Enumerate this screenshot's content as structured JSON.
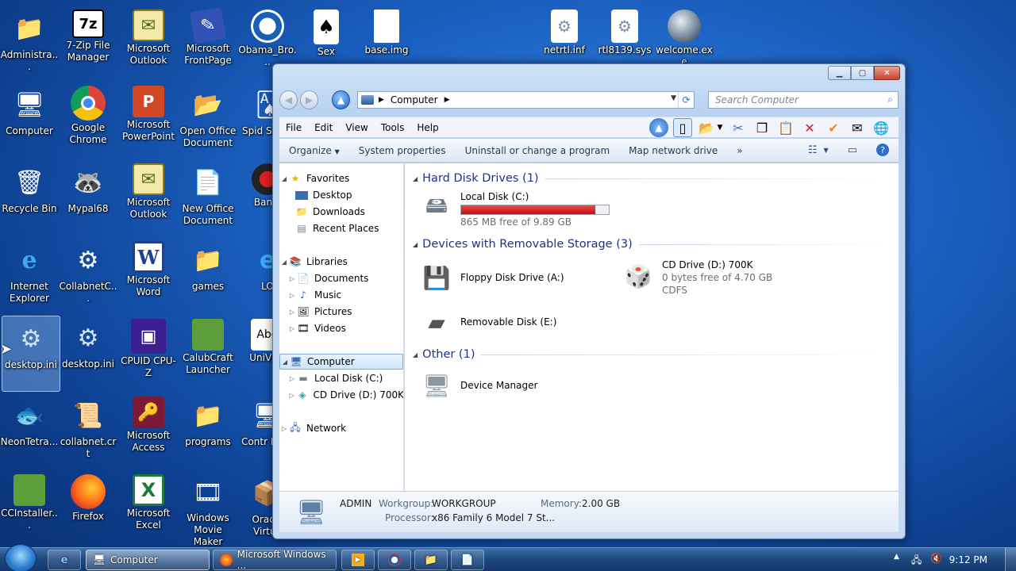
{
  "desktop": {
    "icons": [
      {
        "label": "Administra...",
        "icon": "user-folder-icon"
      },
      {
        "label": "7-Zip File Manager",
        "icon": "7zip-icon"
      },
      {
        "label": "Microsoft Outlook",
        "icon": "outlook-icon"
      },
      {
        "label": "Microsoft FrontPage",
        "icon": "frontpage-icon"
      },
      {
        "label": "Obama_Bro...",
        "icon": "obama-logo-icon"
      },
      {
        "label": "Sex",
        "icon": "playing-card-icon"
      },
      {
        "label": "base.img",
        "icon": "file-icon"
      },
      {
        "label": "netrtl.inf",
        "icon": "config-file-icon"
      },
      {
        "label": "rtl8139.sys",
        "icon": "system-file-icon"
      },
      {
        "label": "welcome.exe",
        "icon": "globe-exe-icon"
      },
      {
        "label": "Computer",
        "icon": "computer-icon"
      },
      {
        "label": "Google Chrome",
        "icon": "chrome-icon"
      },
      {
        "label": "Microsoft PowerPoint",
        "icon": "powerpoint-icon"
      },
      {
        "label": "Open Office Document",
        "icon": "office-folder-icon"
      },
      {
        "label": "Spid Solitu",
        "icon": "spider-solitaire-icon"
      },
      {
        "label": "Recycle Bin",
        "icon": "recycle-bin-icon"
      },
      {
        "label": "Mypal68",
        "icon": "mypal-icon"
      },
      {
        "label": "Microsoft Outlook",
        "icon": "outlook-icon"
      },
      {
        "label": "New Office Document",
        "icon": "office-doc-icon"
      },
      {
        "label": "Bandi",
        "icon": "bandicam-icon"
      },
      {
        "label": "Internet Explorer",
        "icon": "ie-icon"
      },
      {
        "label": "CollabnetC...",
        "icon": "collabnet-icon"
      },
      {
        "label": "Microsoft Word",
        "icon": "word-icon"
      },
      {
        "label": "games",
        "icon": "folder-icon"
      },
      {
        "label": "LO",
        "icon": "ie-icon"
      },
      {
        "label": "desktop.ini",
        "icon": "config-file-icon"
      },
      {
        "label": "desktop.ini",
        "icon": "config-file-icon"
      },
      {
        "label": "CPUID CPU-Z",
        "icon": "cpuz-icon"
      },
      {
        "label": "CalubCraft Launcher",
        "icon": "minecraft-icon"
      },
      {
        "label": "UniVGA",
        "icon": "font-icon"
      },
      {
        "label": "NeonTetra...",
        "icon": "fish-icon"
      },
      {
        "label": "collabnet.crt",
        "icon": "certificate-icon"
      },
      {
        "label": "Microsoft Access",
        "icon": "access-icon"
      },
      {
        "label": "programs",
        "icon": "folder-icon"
      },
      {
        "label": "Contr Pane",
        "icon": "control-panel-icon"
      },
      {
        "label": "CCInstaller...",
        "icon": "minecraft-icon"
      },
      {
        "label": "Firefox",
        "icon": "firefox-icon"
      },
      {
        "label": "Microsoft Excel",
        "icon": "excel-icon"
      },
      {
        "label": "Windows Movie Maker",
        "icon": "movie-maker-icon"
      },
      {
        "label": "Oracle Virtua",
        "icon": "virtualbox-icon"
      }
    ]
  },
  "window": {
    "breadcrumb": "Computer",
    "search_placeholder": "Search Computer",
    "menu": [
      "File",
      "Edit",
      "View",
      "Tools",
      "Help"
    ],
    "commands": [
      "Organize",
      "System properties",
      "Uninstall or change a program",
      "Map network drive",
      "»"
    ],
    "nav": {
      "favorites": "Favorites",
      "desktop": "Desktop",
      "downloads": "Downloads",
      "recent": "Recent Places",
      "libraries": "Libraries",
      "documents": "Documents",
      "music": "Music",
      "pictures": "Pictures",
      "videos": "Videos",
      "computer": "Computer",
      "local_disk": "Local Disk (C:)",
      "cd_drive": "CD Drive (D:) 700K",
      "network": "Network"
    },
    "groups": {
      "hdd": "Hard Disk Drives (1)",
      "removable": "Devices with Removable Storage (3)",
      "other": "Other (1)"
    },
    "items": {
      "local_disk_name": "Local Disk (C:)",
      "local_disk_free": "865 MB free of 9.89 GB",
      "local_disk_used_fraction": 0.91,
      "floppy": "Floppy Disk Drive (A:)",
      "cd_name": "CD Drive (D:) 700K",
      "cd_free": "0 bytes free of 4.70 GB",
      "cd_fs": "CDFS",
      "removable": "Removable Disk (E:)",
      "device_manager": "Device Manager"
    },
    "details": {
      "name": "ADMIN",
      "workgroup_label": "Workgroup:",
      "workgroup": "WORKGROUP",
      "memory_label": "Memory:",
      "memory": "2.00 GB",
      "processor_label": "Processor:",
      "processor": "x86 Family 6 Model 7 St..."
    }
  },
  "taskbar": {
    "computer_btn": "Computer",
    "browser_btn": "Microsoft Windows ...",
    "clock": "9:12 PM"
  },
  "colors": {
    "disk_bar_fill": "#d01c1c",
    "group_header": "#1e3287"
  }
}
